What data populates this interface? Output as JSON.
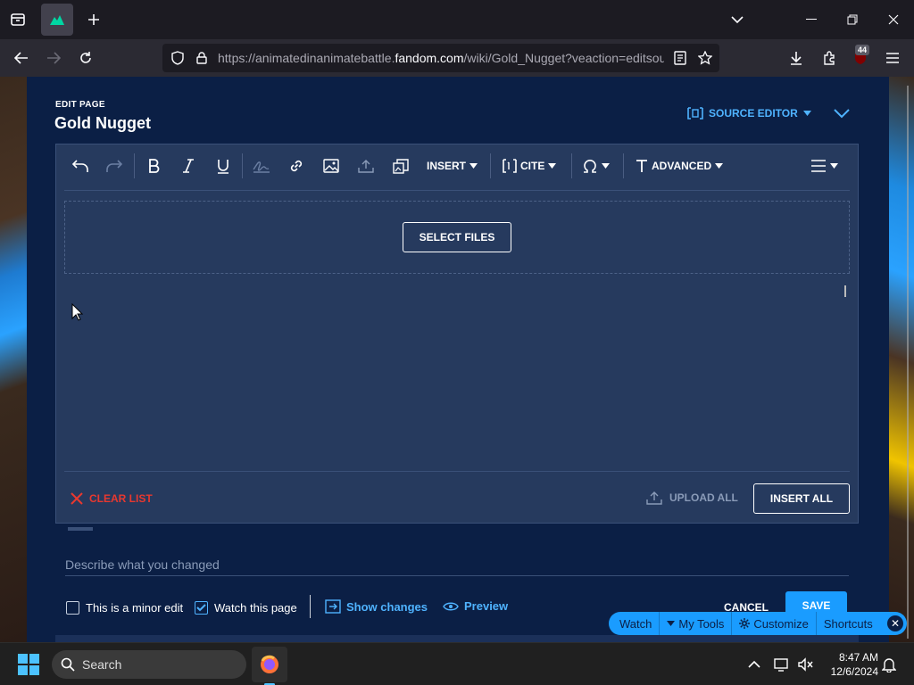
{
  "browser": {
    "url_prefix": "https://animatedinanimatebattle.",
    "url_domain": "fandom.com",
    "url_suffix": "/wiki/Gold_Nugget?veaction=editsource",
    "extensions_badge": "44"
  },
  "editor": {
    "edit_label": "EDIT PAGE",
    "page_title": "Gold Nugget",
    "source_editor_label": "SOURCE EDITOR",
    "toolbar": {
      "insert": "INSERT",
      "cite": "CITE",
      "advanced": "ADVANCED"
    },
    "upload": {
      "select_files": "SELECT FILES",
      "clear_list": "CLEAR LIST",
      "upload_all": "UPLOAD ALL",
      "insert_all": "INSERT ALL"
    },
    "summary_placeholder": "Describe what you changed",
    "minor_edit_label": "This is a minor edit",
    "minor_edit_checked": false,
    "watch_page_label": "Watch this page",
    "watch_page_checked": true,
    "show_changes": "Show changes",
    "preview": "Preview",
    "cancel": "CANCEL",
    "save": "SAVE"
  },
  "floating_toolbar": {
    "watch": "Watch",
    "my_tools": "My Tools",
    "customize": "Customize",
    "shortcuts": "Shortcuts"
  },
  "taskbar": {
    "search_placeholder": "Search",
    "time": "8:47 AM",
    "date": "12/6/2024"
  },
  "colors": {
    "panel_bg": "#0b1f45",
    "editor_box": "#263a5e",
    "accent": "#4fb3ff",
    "save_button": "#1a9cff",
    "clear_list": "#e8382f"
  }
}
